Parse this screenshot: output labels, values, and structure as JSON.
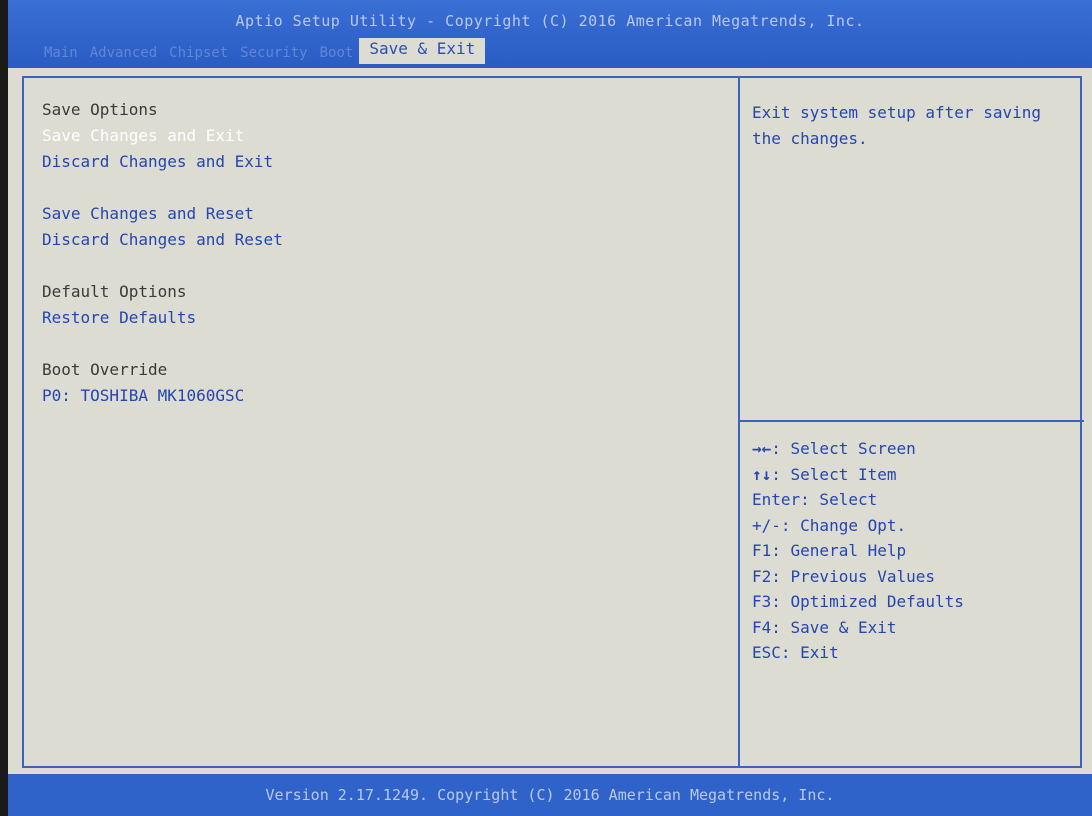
{
  "header": {
    "title": "Aptio Setup Utility - Copyright (C) 2016 American Megatrends, Inc.",
    "tabs": [
      {
        "label": "Main"
      },
      {
        "label": "Advanced"
      },
      {
        "label": "Chipset"
      },
      {
        "label": "Security"
      },
      {
        "label": "Boot"
      },
      {
        "label": "Save & Exit"
      }
    ]
  },
  "menu": {
    "save_options_heading": "Save Options",
    "save_changes_exit": "Save Changes and Exit",
    "discard_changes_exit": "Discard Changes and Exit",
    "save_changes_reset": "Save Changes and Reset",
    "discard_changes_reset": "Discard Changes and Reset",
    "default_options_heading": "Default Options",
    "restore_defaults": "Restore Defaults",
    "boot_override_heading": "Boot Override",
    "boot_device": "P0: TOSHIBA MK1060GSC"
  },
  "help": {
    "text": "Exit system setup after saving the changes."
  },
  "keys": [
    {
      "glyph": "→←",
      "label": ": Select Screen"
    },
    {
      "glyph": "↑↓",
      "label": ": Select Item"
    },
    {
      "glyph": "",
      "label": "Enter: Select"
    },
    {
      "glyph": "",
      "label": "+/-: Change Opt."
    },
    {
      "glyph": "",
      "label": "F1: General Help"
    },
    {
      "glyph": "",
      "label": "F2: Previous Values"
    },
    {
      "glyph": "",
      "label": "F3: Optimized Defaults"
    },
    {
      "glyph": "",
      "label": "F4: Save & Exit"
    },
    {
      "glyph": "",
      "label": "ESC: Exit"
    }
  ],
  "footer": {
    "text": "Version 2.17.1249. Copyright (C) 2016 American Megatrends, Inc."
  }
}
